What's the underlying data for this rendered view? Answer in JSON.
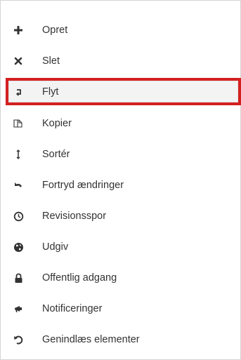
{
  "menu": {
    "items": [
      {
        "label": "Opret",
        "icon": "plus-icon"
      },
      {
        "label": "Slet",
        "icon": "times-icon"
      },
      {
        "label": "Flyt",
        "icon": "move-icon",
        "selected": true
      },
      {
        "label": "Kopier",
        "icon": "copy-icon"
      },
      {
        "label": "Sortér",
        "icon": "sort-icon"
      },
      {
        "label": "Fortryd ændringer",
        "icon": "undo-icon"
      },
      {
        "label": "Revisionsspor",
        "icon": "clock-icon"
      },
      {
        "label": "Udgiv",
        "icon": "globe-icon"
      },
      {
        "label": "Offentlig adgang",
        "icon": "lock-icon"
      },
      {
        "label": "Notificeringer",
        "icon": "bullhorn-icon"
      },
      {
        "label": "Genindlæs elementer",
        "icon": "reload-icon"
      }
    ]
  },
  "colors": {
    "text": "#333333",
    "icon": "#333333",
    "highlight_border": "#d42020",
    "selected_background": "#f3f3f3"
  }
}
